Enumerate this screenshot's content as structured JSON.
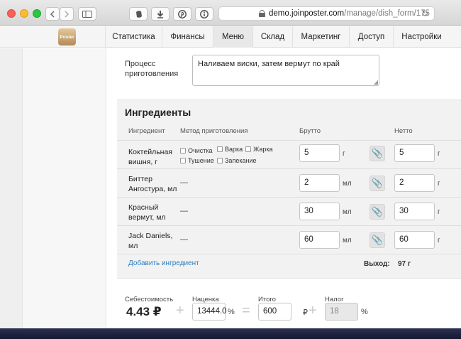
{
  "browser": {
    "url_host": "demo.joinposter.com",
    "url_path": "/manage/dish_form/175"
  },
  "app": {
    "logo_text": "Poster",
    "tabs": [
      "Статистика",
      "Финансы",
      "Меню",
      "Склад",
      "Маркетинг",
      "Доступ",
      "Настройки"
    ],
    "active_tab": "Меню"
  },
  "process": {
    "label": "Процесс приготовления",
    "value": "Наливаем виски, затем вермут по край"
  },
  "ingredients": {
    "title": "Ингредиенты",
    "headers": {
      "ingredient": "Ингредиент",
      "method": "Метод приготовления",
      "gross": "Брутто",
      "net": "Нетто"
    },
    "methods": [
      "Очистка",
      "Варка",
      "Жарка",
      "Тушение",
      "Запекание"
    ],
    "rows": [
      {
        "name": "Коктейльная вишня, г",
        "method": "",
        "gross": "5",
        "gross_unit": "г",
        "net": "5",
        "net_unit": "г"
      },
      {
        "name": "Биттер Ангостура, мл",
        "method": "—",
        "gross": "2",
        "gross_unit": "мл",
        "net": "2",
        "net_unit": "г"
      },
      {
        "name": "Красный вермут, мл",
        "method": "—",
        "gross": "30",
        "gross_unit": "мл",
        "net": "30",
        "net_unit": "г"
      },
      {
        "name": "Jack Daniels, мл",
        "method": "—",
        "gross": "60",
        "gross_unit": "мл",
        "net": "60",
        "net_unit": "г"
      }
    ],
    "add_link": "Добавить ингредиент",
    "yield_label": "Выход:",
    "yield_value": "97 г"
  },
  "summary": {
    "cost_label": "Себестоимость",
    "cost_value": "4.43 ₽",
    "markup_label": "Наценка",
    "markup_value": "13444.0",
    "markup_unit": "%",
    "total_label": "Итого",
    "total_value": "600",
    "total_unit": "₽",
    "tax_label": "Налог",
    "tax_value": "18",
    "tax_unit": "%",
    "op_plus": "+",
    "op_equals": "="
  }
}
